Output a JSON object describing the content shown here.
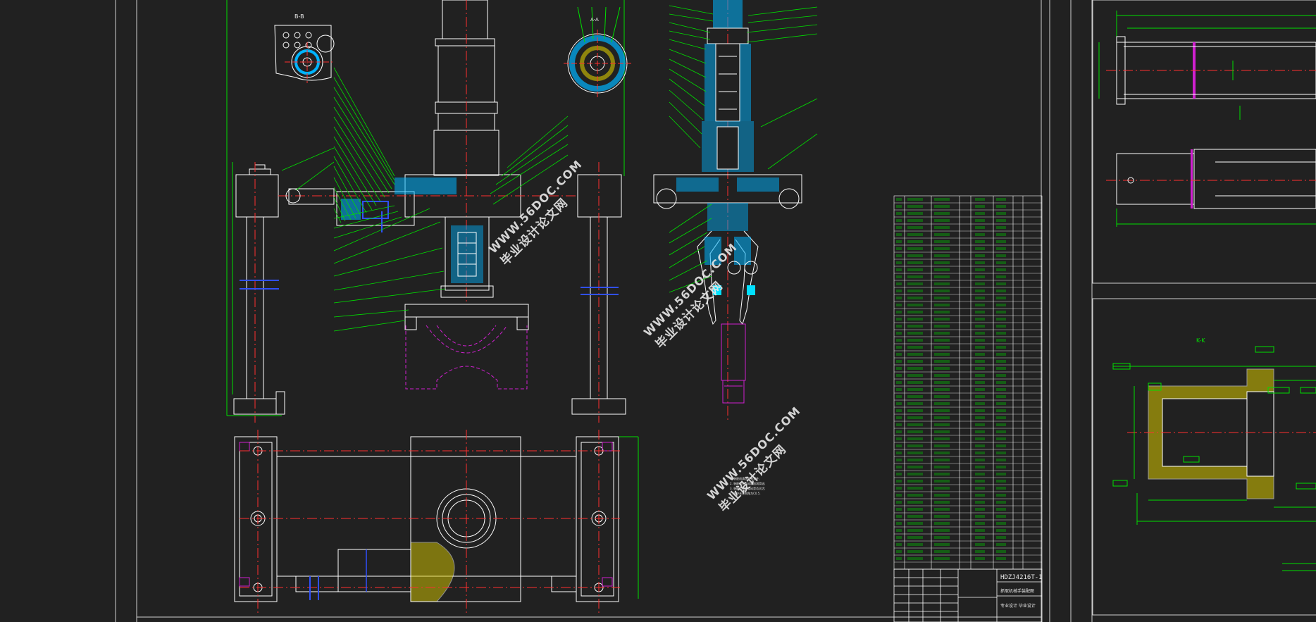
{
  "drawing": {
    "view_labels": {
      "section_bb": "B-B",
      "section_aa": "A-A",
      "section_kk": "K-K"
    },
    "title_block": {
      "drawing_number": "HDZJ4216T-1",
      "subtitle": "抓取机械手装配图",
      "designer_line": "专业设计 毕业设计"
    },
    "tech_notes": [
      "1. 装配前清洗所有零件;",
      "2. 装配时各运动副加润滑油;",
      "3. 装配后检查运动是否灵活;",
      "4. 图中未注倒角为C0.5."
    ]
  },
  "watermarks": [
    {
      "url": "WWW.56DOC.COM",
      "cn": "毕业设计论文网"
    },
    {
      "url": "WWW.56DOC.COM",
      "cn": "毕业设计论文网"
    },
    {
      "url": "WWW.56DOC.COM",
      "cn": "毕业设计论文网"
    }
  ],
  "colors": {
    "background": "#212121",
    "outline": "#ffffff",
    "centerline": "#ff3030",
    "dimension": "#00e000",
    "section_hatch": "#00b4ff",
    "hidden_line": "#d020d0",
    "blue_feature": "#3050ff",
    "yellow_hatch": "#d8c800"
  }
}
